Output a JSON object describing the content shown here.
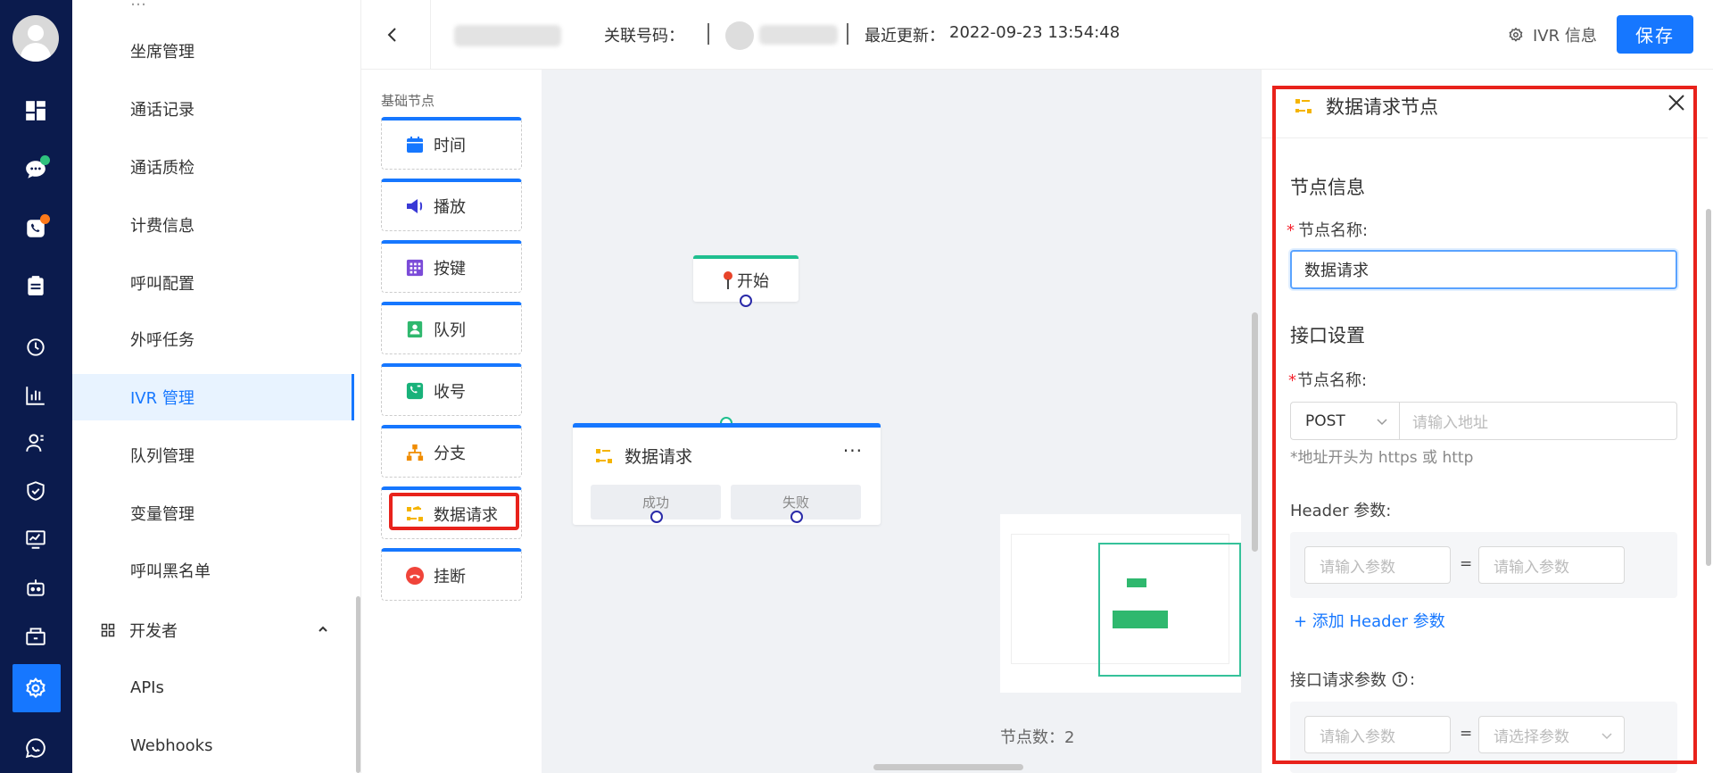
{
  "sidebar": {
    "items": [
      {
        "label": "坐席管理"
      },
      {
        "label": "通话记录"
      },
      {
        "label": "通话质检"
      },
      {
        "label": "计费信息"
      },
      {
        "label": "呼叫配置"
      },
      {
        "label": "外呼任务"
      },
      {
        "label": "IVR 管理",
        "active": true
      },
      {
        "label": "队列管理"
      },
      {
        "label": "变量管理"
      },
      {
        "label": "呼叫黑名单"
      }
    ],
    "group": {
      "label": "开发者",
      "expanded": true
    },
    "sub_items": [
      {
        "label": "APIs"
      },
      {
        "label": "Webhooks"
      }
    ]
  },
  "rail": {
    "icons": [
      "avatar",
      "dashboard-icon",
      "chat-icon",
      "phone-icon",
      "clipboard-icon",
      "history-icon",
      "bar-chart-icon",
      "contacts-icon",
      "shield-icon",
      "monitor-chart-icon",
      "robot-icon",
      "package-icon",
      "settings-icon",
      "message-icon"
    ],
    "active": "settings-icon",
    "badge_colors": {
      "chat": "#2fc27e",
      "phone": "#ff7a1a"
    }
  },
  "header": {
    "linked_number_label": "关联号码：",
    "last_updated_label": "最近更新：",
    "last_updated_value": "2022-09-23 13:54:48",
    "ivr_info_label": "IVR 信息",
    "save_label": "保存"
  },
  "palette": {
    "title": "基础节点",
    "items": [
      {
        "label": "时间",
        "icon": "calendar-icon"
      },
      {
        "label": "播放",
        "icon": "speaker-icon"
      },
      {
        "label": "按键",
        "icon": "keypad-icon"
      },
      {
        "label": "队列",
        "icon": "queue-icon"
      },
      {
        "label": "收号",
        "icon": "collect-digits-icon"
      },
      {
        "label": "分支",
        "icon": "branch-icon"
      },
      {
        "label": "数据请求",
        "icon": "data-request-icon",
        "highlighted": true
      },
      {
        "label": "挂断",
        "icon": "hangup-icon"
      }
    ]
  },
  "canvas": {
    "start_node": {
      "label": "开始"
    },
    "request_node": {
      "label": "数据请求",
      "more": "···",
      "outlets": [
        "成功",
        "失败"
      ]
    },
    "node_count_label": "节点数：",
    "node_count_value": "2"
  },
  "panel": {
    "title": "数据请求节点",
    "section_node_info": "节点信息",
    "node_name_label": "节点名称:",
    "node_name_value": "数据请求",
    "section_api": "接口设置",
    "api_name_label": "节点名称:",
    "method": "POST",
    "url_placeholder": "请输入地址",
    "url_hint": "*地址开头为 https 或 http",
    "header_params_label": "Header 参数:",
    "param_placeholder": "请输入参数",
    "equals": "=",
    "add_header_link": "+ 添加 Header 参数",
    "request_params_label": "接口请求参数",
    "request_params_colon": ":",
    "select_param_placeholder": "请选择参数"
  },
  "colors": {
    "primary": "#1677ff",
    "highlight": "#e8221b",
    "rail_bg": "#0b1b4d",
    "start_green": "#1fbf8f"
  }
}
